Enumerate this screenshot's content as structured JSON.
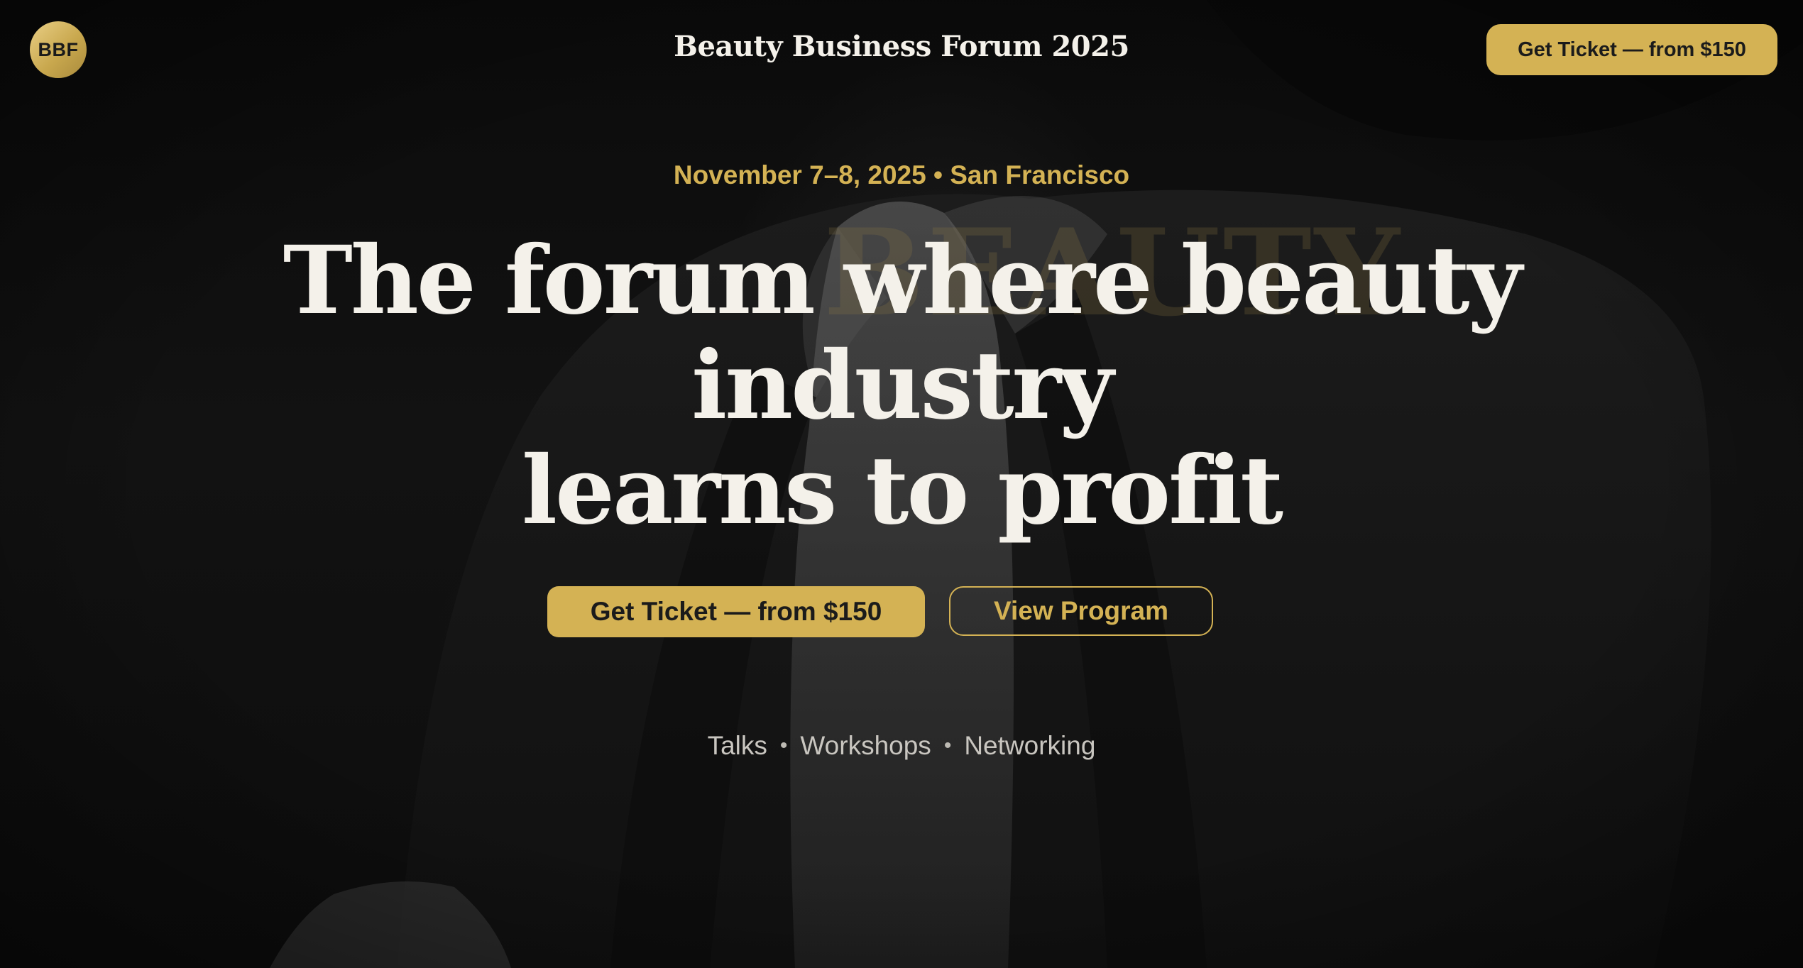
{
  "header": {
    "logo_text": "BBF",
    "title": "Beauty Business Forum 2025",
    "cta_label": "Get Ticket — from $150"
  },
  "hero": {
    "date_location": "November 7–8, 2025 • San Francisco",
    "watermark": "BEAUTY",
    "headline_lines": [
      "The forum where beauty",
      "industry",
      "learns to profit"
    ],
    "primary_cta": "Get Ticket — from $150",
    "secondary_cta": "View Program",
    "features": [
      "Talks",
      "Workshops",
      "Networking"
    ],
    "separator": "•"
  },
  "colors": {
    "accent_gold": "#d4b254",
    "background": "#0e0e0e",
    "headline_text": "#f4f1ea"
  }
}
